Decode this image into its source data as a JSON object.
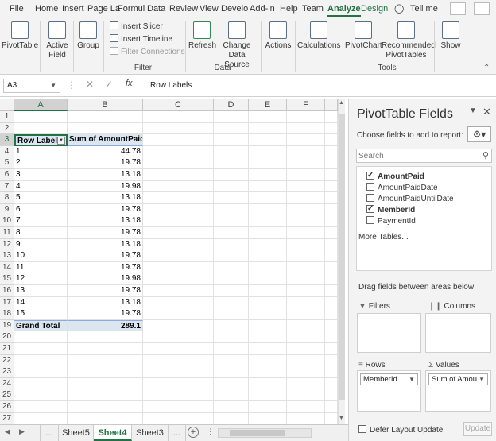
{
  "ribbon_tabs": [
    "File",
    "Home",
    "Insert",
    "Page La",
    "Formul",
    "Data",
    "Review",
    "View",
    "Develo",
    "Add-in",
    "Help",
    "Team",
    "Analyze",
    "Design"
  ],
  "tell_me": "Tell me",
  "ribbon": {
    "pivottable": "PivotTable",
    "active_field": "Active Field",
    "group": "Group",
    "insert_slicer": "Insert Slicer",
    "insert_timeline": "Insert Timeline",
    "filter_connections": "Filter Connections",
    "filter_group": "Filter",
    "refresh": "Refresh",
    "change_source": "Change Data Source",
    "data_group": "Data",
    "actions": "Actions",
    "calculations": "Calculations",
    "pivotchart": "PivotChart",
    "recommended": "Recommended PivotTables",
    "tools_group": "Tools",
    "show": "Show"
  },
  "formula": {
    "name_box": "A3",
    "fx": "fx",
    "value": "Row Labels"
  },
  "columns": [
    "A",
    "B",
    "C",
    "D",
    "E",
    "F"
  ],
  "rows": [
    "1",
    "2",
    "3",
    "4",
    "5",
    "6",
    "7",
    "8",
    "9",
    "10",
    "11",
    "12",
    "13",
    "14",
    "15",
    "16",
    "17",
    "18",
    "19",
    "20",
    "21",
    "22",
    "23",
    "24",
    "25",
    "26",
    "27"
  ],
  "pivot": {
    "header_a": "Row Labels",
    "header_b": "Sum of AmountPaid",
    "data": [
      [
        "1",
        "44.78"
      ],
      [
        "2",
        "19.78"
      ],
      [
        "3",
        "13.18"
      ],
      [
        "4",
        "19.98"
      ],
      [
        "5",
        "13.18"
      ],
      [
        "6",
        "19.78"
      ],
      [
        "7",
        "13.18"
      ],
      [
        "8",
        "19.78"
      ],
      [
        "9",
        "13.18"
      ],
      [
        "10",
        "19.78"
      ],
      [
        "11",
        "19.78"
      ],
      [
        "12",
        "19.98"
      ],
      [
        "13",
        "19.78"
      ],
      [
        "14",
        "13.18"
      ],
      [
        "15",
        "19.78"
      ]
    ],
    "total_label": "Grand Total",
    "total_value": "289.1"
  },
  "sheets": [
    "...",
    "Sheet5",
    "Sheet4",
    "Sheet3",
    "..."
  ],
  "active_sheet": "Sheet4",
  "pane": {
    "title": "PivotTable Fields",
    "choose": "Choose fields to add to report:",
    "search_placeholder": "Search",
    "fields": [
      {
        "name": "AmountPaid",
        "checked": true
      },
      {
        "name": "AmountPaidDate",
        "checked": false
      },
      {
        "name": "AmountPaidUntilDate",
        "checked": false
      },
      {
        "name": "MemberId",
        "checked": true
      },
      {
        "name": "PaymentId",
        "checked": false
      }
    ],
    "more_tables": "More Tables...",
    "drag": "Drag fields between areas below:",
    "filters": "Filters",
    "columns": "Columns",
    "rows": "Rows",
    "values": "Values",
    "rows_field": "MemberId",
    "values_field": "Sum of Amou...",
    "defer": "Defer Layout Update",
    "update": "Update"
  },
  "colors": {
    "accent": "#217346",
    "pivot_header": "#dce6f1"
  }
}
